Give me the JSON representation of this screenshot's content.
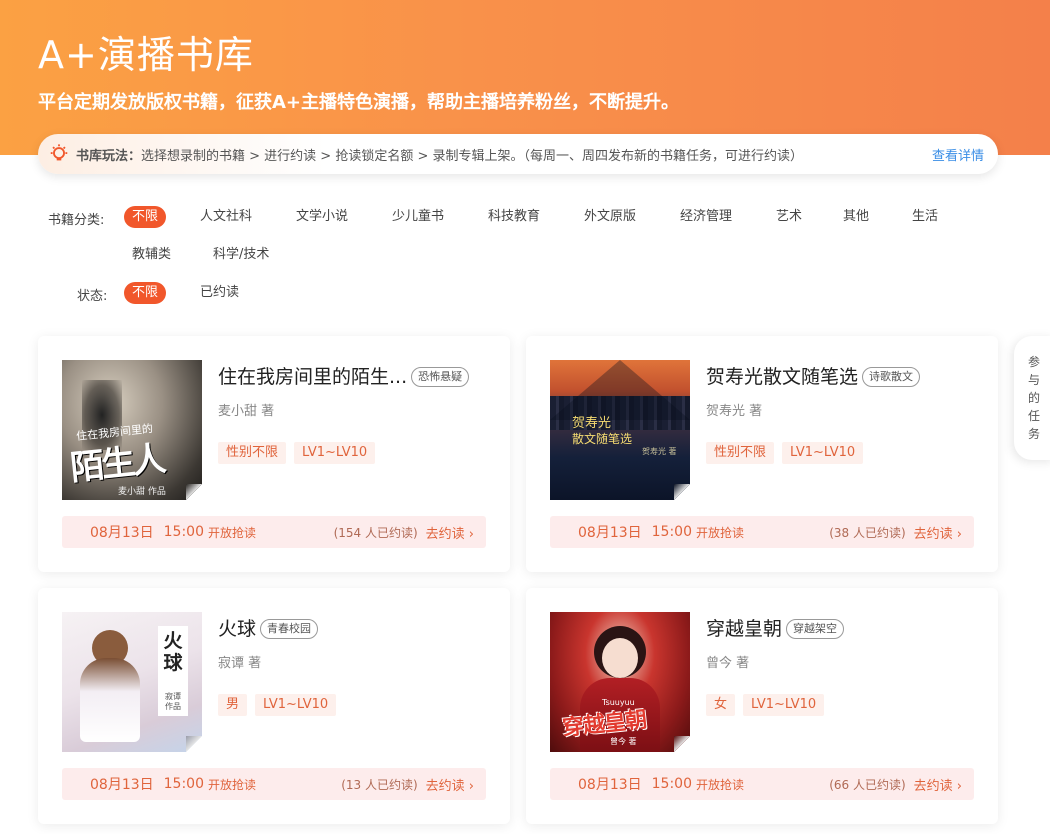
{
  "hero": {
    "title": "A+演播书库",
    "subtitle": "平台定期发放版权书籍，征获A+主播特色演播，帮助主播培养粉丝，不断提升。"
  },
  "rules": {
    "label": "书库玩法：",
    "text": "选择想录制的书籍 > 进行约读 > 抢读锁定名额 > 录制专辑上架。（每周一、周四发布新的书籍任务，可进行约读）",
    "link": "查看详情"
  },
  "filters": {
    "category_label": "书籍分类:",
    "categories": [
      "不限",
      "人文社科",
      "文学小说",
      "少儿童书",
      "科技教育",
      "外文原版",
      "经济管理",
      "艺术",
      "其他",
      "生活",
      "教辅类",
      "科学/技术"
    ],
    "status_label": "状态:",
    "statuses": [
      "不限",
      "已约读"
    ]
  },
  "side_tab": {
    "chars": [
      "参",
      "与",
      "的",
      "任",
      "务"
    ]
  },
  "books": [
    {
      "title": "住在我房间里的陌生...",
      "genre": "恐怖悬疑",
      "author": "麦小甜 著",
      "gender": "性别不限",
      "level": "LV1~LV10",
      "date": "08月13日",
      "time": "15:00",
      "open": "开放抢读",
      "count": "(154 人已约读)",
      "reserve": "去约读 ›",
      "cover_small": "住在我房间里的",
      "cover_big": "陌生人",
      "cover_author": "麦小甜 作品"
    },
    {
      "title": "贺寿光散文随笔选",
      "genre": "诗歌散文",
      "author": "贺寿光 著",
      "gender": "性别不限",
      "level": "LV1~LV10",
      "date": "08月13日",
      "time": "15:00",
      "open": "开放抢读",
      "count": "(38 人已约读)",
      "reserve": "去约读 ›",
      "cover_small": "贺寿光",
      "cover_big": "散文随笔选",
      "cover_author": "贺寿光 著"
    },
    {
      "title": "火球",
      "genre": "青春校园",
      "author": "寂谭 著",
      "gender": "男",
      "level": "LV1~LV10",
      "date": "08月13日",
      "time": "15:00",
      "open": "开放抢读",
      "count": "(13 人已约读)",
      "reserve": "去约读 ›",
      "cover_small": "",
      "cover_big": "火球",
      "cover_author": "寂谭 作品"
    },
    {
      "title": "穿越皇朝",
      "genre": "穿越架空",
      "author": "曾今 著",
      "gender": "女",
      "level": "LV1~LV10",
      "date": "08月13日",
      "time": "15:00",
      "open": "开放抢读",
      "count": "(66 人已约读)",
      "reserve": "去约读 ›",
      "cover_small": "Tsuuyuu",
      "cover_big": "穿越皇朝",
      "cover_author": "曾今 著"
    }
  ],
  "colors": {
    "accent": "#f1572b",
    "hero_start": "#fba143",
    "hero_end": "#f4804a",
    "tag_bg": "#fdf0ec",
    "tag_text": "#e0643c",
    "link": "#3a8ee6"
  }
}
